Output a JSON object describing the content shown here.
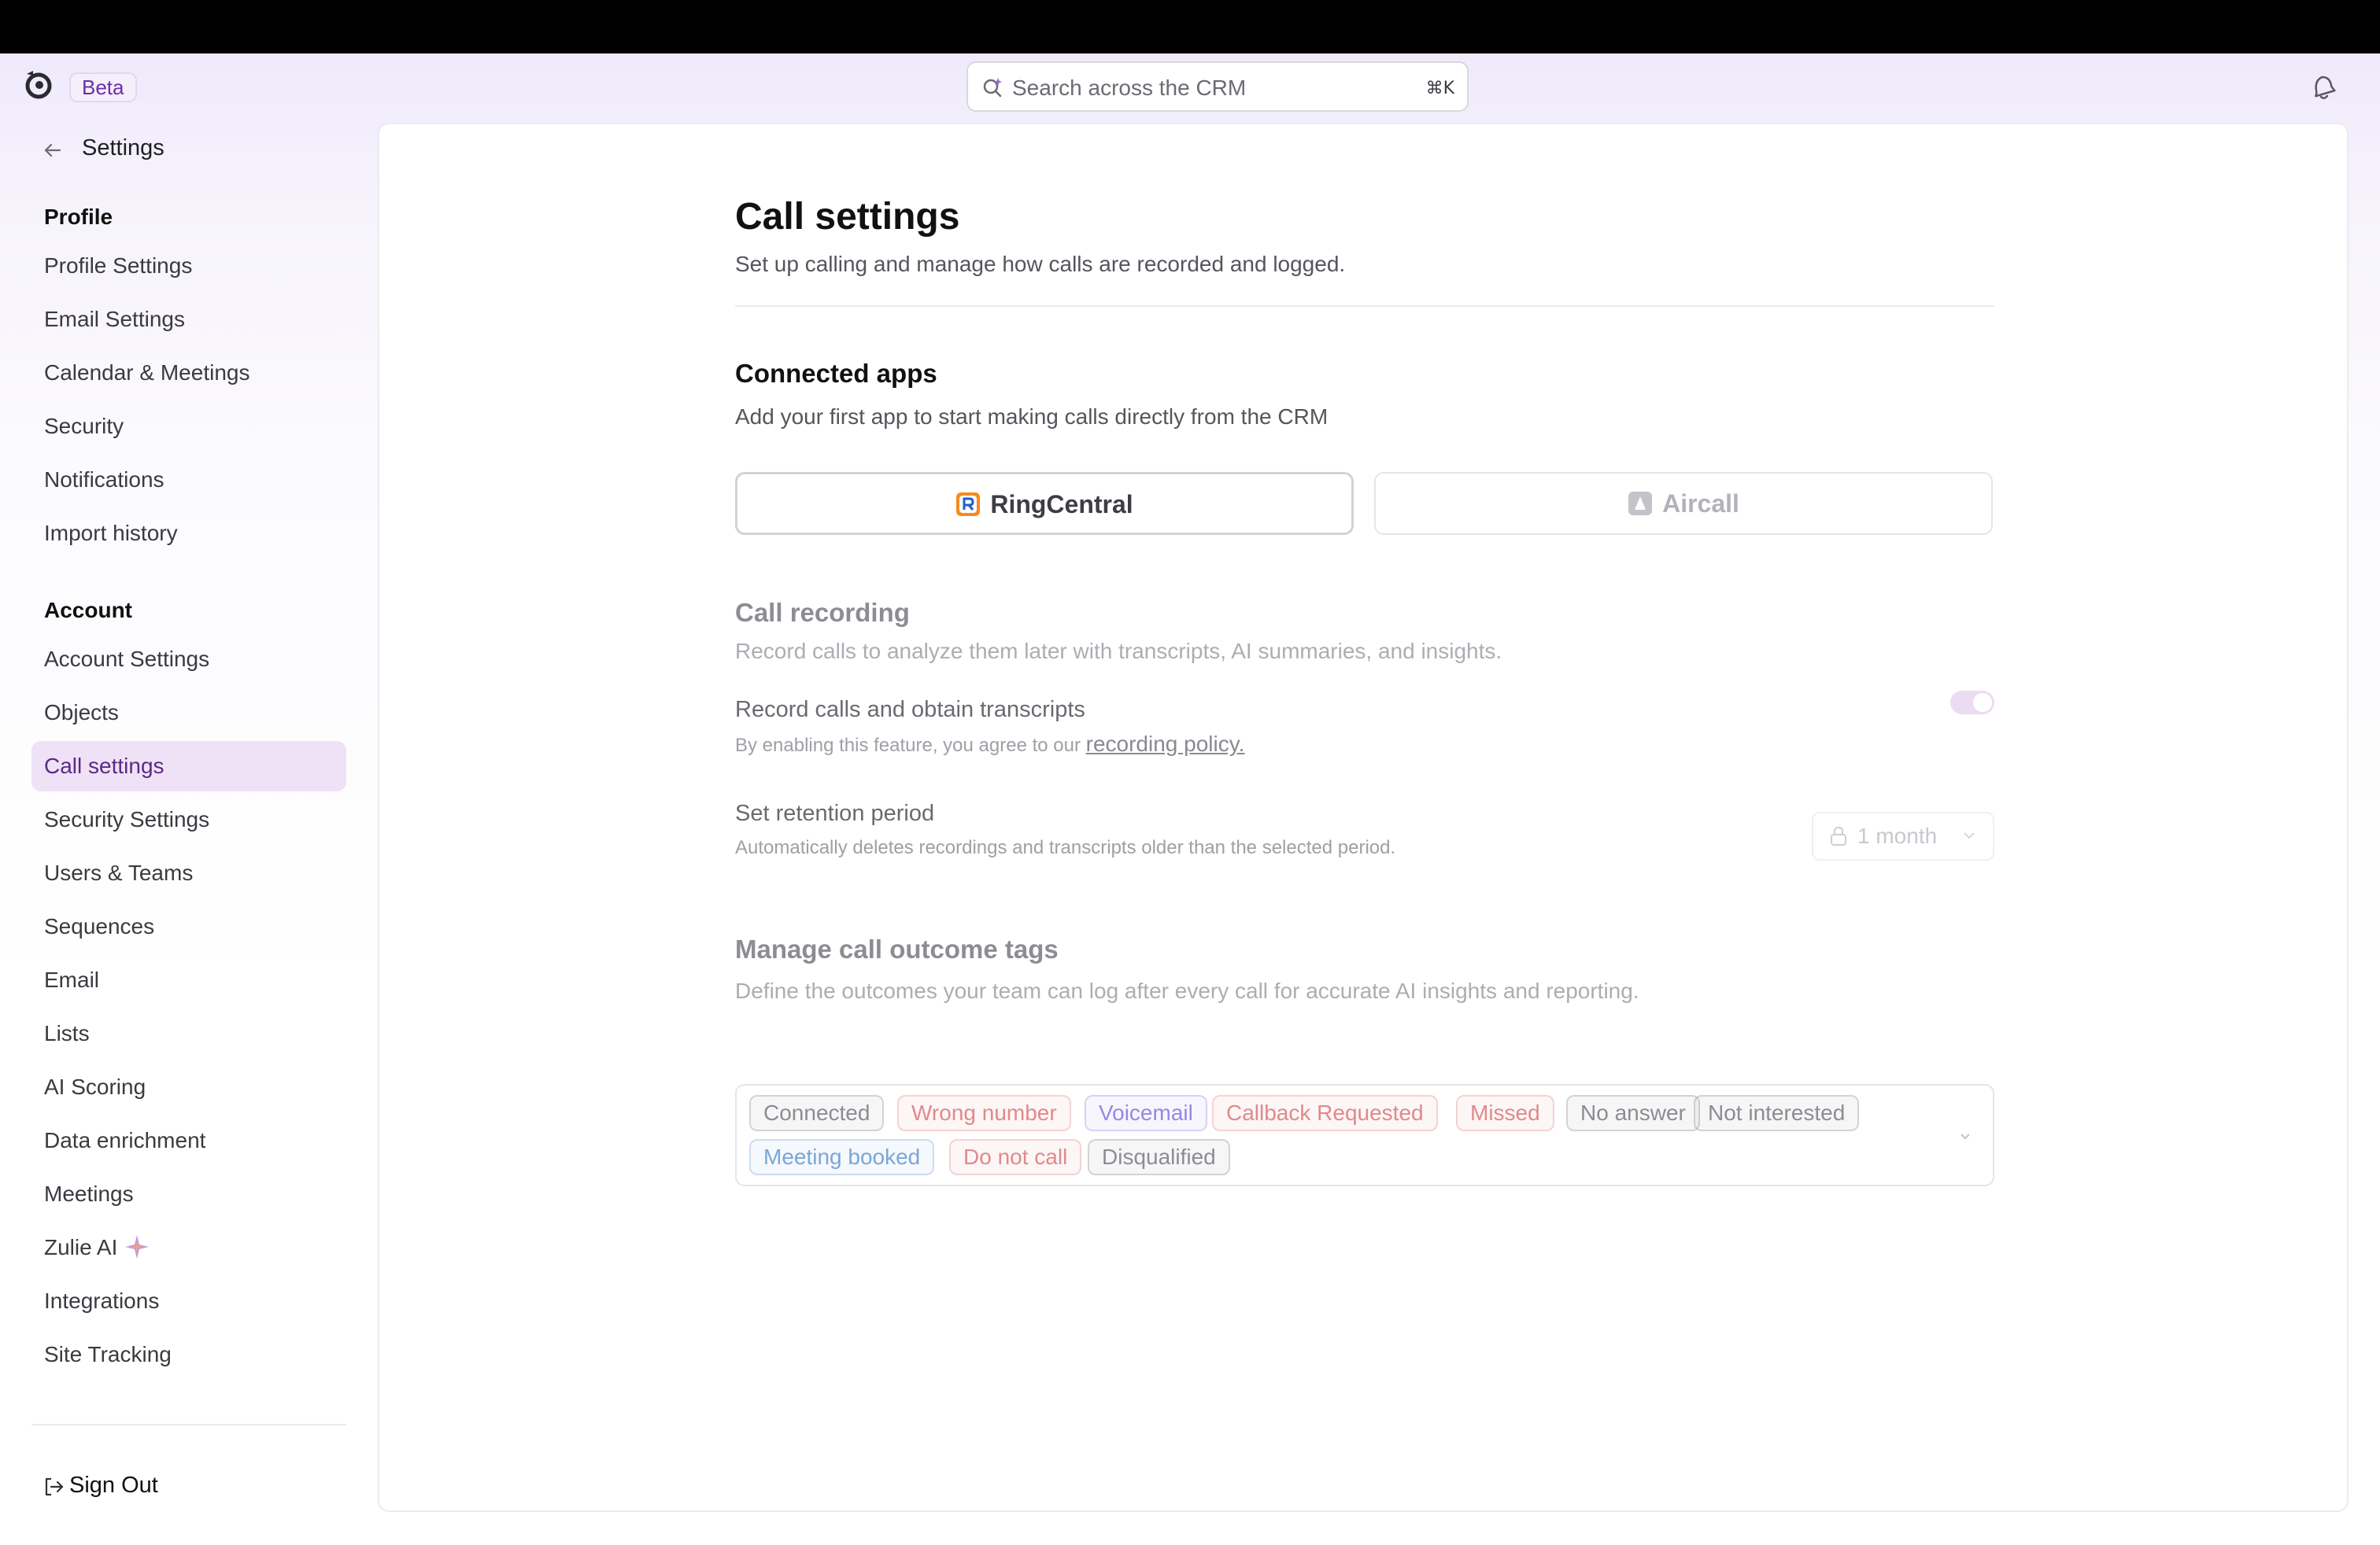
{
  "header": {
    "beta_label": "Beta",
    "search_placeholder": "Search across the CRM",
    "search_shortcut": "⌘K"
  },
  "sidebar": {
    "back_label": "Settings",
    "profile_section": "Profile",
    "profile_items": [
      "Profile Settings",
      "Email Settings",
      "Calendar & Meetings",
      "Security",
      "Notifications",
      "Import history"
    ],
    "account_section": "Account",
    "account_items": [
      "Account Settings",
      "Objects",
      "Call settings",
      "Security Settings",
      "Users & Teams",
      "Sequences",
      "Email",
      "Lists",
      "AI Scoring",
      "Data enrichment",
      "Meetings",
      "Zulie AI",
      "Integrations",
      "Site Tracking"
    ],
    "active_item": "Call settings",
    "sign_out": "Sign Out"
  },
  "main": {
    "title": "Call settings",
    "subtitle": "Set up calling and manage how calls are recorded and logged.",
    "connected_apps": {
      "title": "Connected apps",
      "description": "Add your first app to start making calls directly from the CRM",
      "apps": [
        "RingCentral",
        "Aircall"
      ]
    },
    "call_recording": {
      "title": "Call recording",
      "description": "Record calls to analyze them later with transcripts, AI summaries, and insights.",
      "record_title": "Record calls and obtain transcripts",
      "record_sub": "By enabling this feature, you agree to our",
      "record_link": "recording policy.",
      "record_enabled": true,
      "retention_title": "Set retention period",
      "retention_sub": "Automatically deletes recordings and transcripts older than the selected period.",
      "retention_value": "1 month"
    },
    "outcome_tags": {
      "title": "Manage call outcome tags",
      "description": "Define the outcomes your team can log after every call for accurate AI insights and reporting.",
      "tags": [
        {
          "label": "Connected",
          "color": "#8e8c93"
        },
        {
          "label": "Wrong number",
          "color": "#e08a8a"
        },
        {
          "label": "Voicemail",
          "color": "#9a86e0"
        },
        {
          "label": "Callback Requested",
          "color": "#e08a8a"
        },
        {
          "label": "Missed",
          "color": "#e08a8a"
        },
        {
          "label": "No answer",
          "color": "#8e8c93"
        },
        {
          "label": "Not interested",
          "color": "#8e8c93"
        },
        {
          "label": "Meeting booked",
          "color": "#7aa6d8"
        },
        {
          "label": "Do not call",
          "color": "#e08a8a"
        },
        {
          "label": "Disqualified",
          "color": "#8e8c93"
        }
      ]
    }
  },
  "colors": {
    "accent": "#5b2a86",
    "active_bg": "#efe2f6"
  }
}
